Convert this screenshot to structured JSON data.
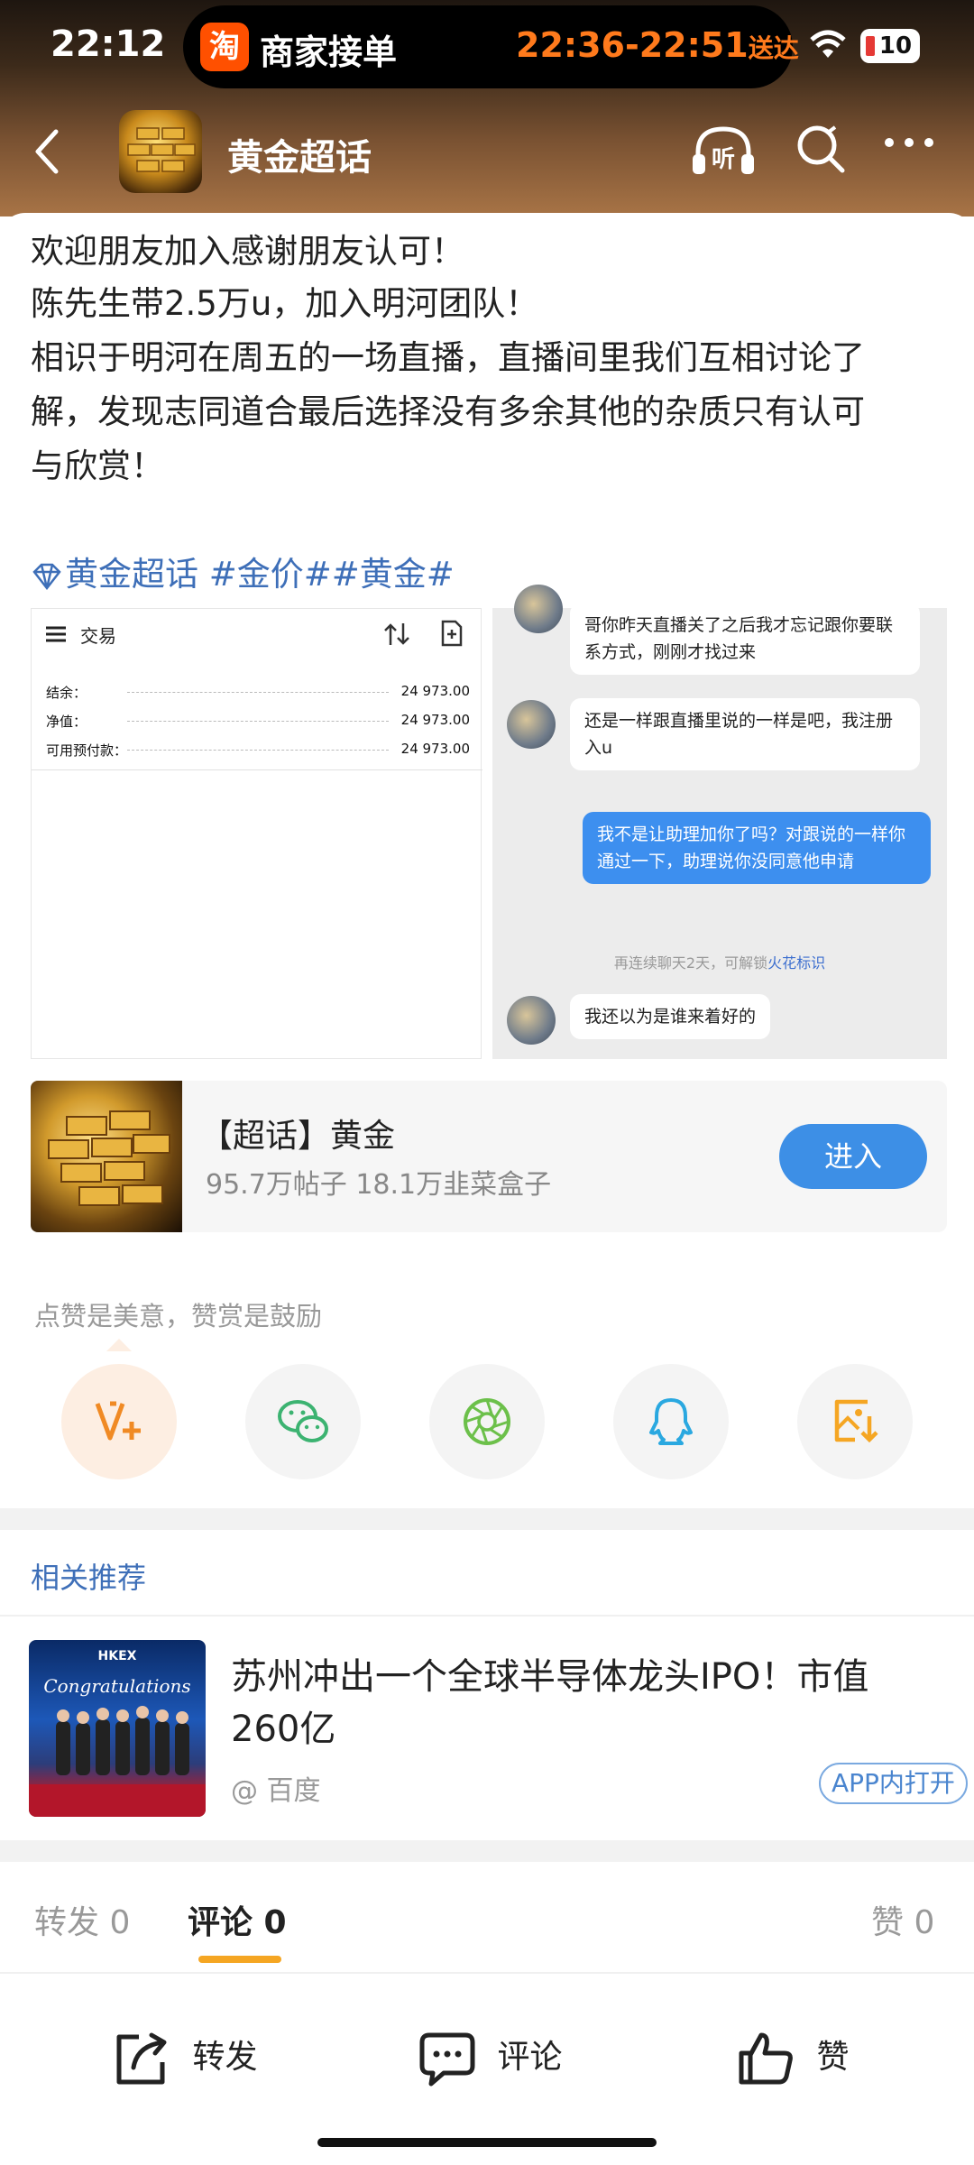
{
  "status_bar": {
    "time": "22:12",
    "merchant_icon": "淘",
    "merchant_text": "商家接单",
    "delivery_time": "22:36-22:51",
    "delivery_suffix": "送达",
    "battery": "10"
  },
  "header": {
    "title": "黄金超话"
  },
  "post": {
    "lines": [
      "欢迎朋友加入感谢朋友认可！",
      "陈先生带2.5万u，加入明河团队！",
      "相识于明河在周五的一场直播，直播间里我们互相讨论了",
      "解，发现志同道合最后选择没有多余其他的杂质只有认可",
      "与欣赏！"
    ],
    "topics": "黄金超话 #金价##黄金#"
  },
  "screenshot_left": {
    "title": "交易",
    "rows": [
      {
        "label": "结余：",
        "value": "24 973.00"
      },
      {
        "label": "净值：",
        "value": "24 973.00"
      },
      {
        "label": "可用预付款：",
        "value": "24 973.00"
      }
    ]
  },
  "screenshot_right": {
    "msg1": "哥你昨天直播关了之后我才忘记跟你要联系方式，刚刚才找过来",
    "msg2": "还是一样跟直播里说的一样是吧，我注册入u",
    "msg3": "我不是让助理加你了吗？对跟说的一样你通过一下，助理说你没同意他申请",
    "notice": "再连续聊天2天，可解锁",
    "notice_link": "火花标识",
    "msg4": "我还以为是谁来着好的"
  },
  "supertopic": {
    "title": "【超话】黄金",
    "stats": "95.7万帖子 18.1万韭菜盒子",
    "enter_label": "进入"
  },
  "reward": {
    "prompt": "点赞是美意，赞赏是鼓励",
    "icons": [
      "v-plus-icon",
      "wechat-icon",
      "moments-icon",
      "qq-icon",
      "save-image-icon"
    ]
  },
  "related": {
    "title": "相关推荐",
    "news_title": "苏州冲出一个全球半导体龙头IPO！市值260亿",
    "news_source": "@ 百度",
    "app_open": "APP内打开",
    "image_banner": "HKEX",
    "image_script": "Congratulations"
  },
  "tabs": {
    "forward": "转发 0",
    "comment": "评论 0",
    "like": "赞 0"
  },
  "bottom": {
    "forward": "转发",
    "comment": "评论",
    "like": "赞"
  },
  "colors": {
    "accent_blue": "#3e6fb8",
    "tab_underline": "#f5a623",
    "enter_button": "#3d8fe6",
    "delivery": "#ff7a1c"
  }
}
